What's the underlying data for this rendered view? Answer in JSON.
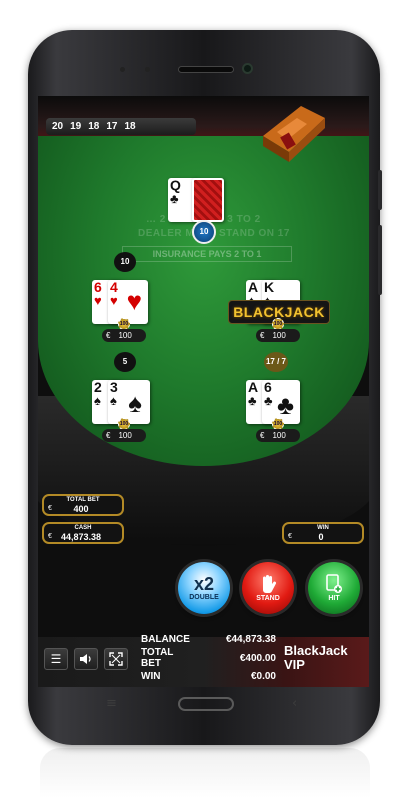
{
  "history": [
    "20",
    "19",
    "18",
    "17",
    "18"
  ],
  "dealer": {
    "cards": [
      {
        "rank": "Q",
        "suit": "♣",
        "color": "blk"
      },
      {
        "rank": "",
        "suit": "",
        "color": "back"
      }
    ],
    "score": "10"
  },
  "felt_text": {
    "line1": "…  2 TO 1 PAYS 3 TO 2",
    "line2": "DEALER MUST STAND ON 17",
    "insurance": "INSURANCE PAYS 2 TO 1"
  },
  "hands": [
    {
      "score": "10",
      "cards": [
        {
          "rank": "6",
          "suit": "♥",
          "color": "red"
        },
        {
          "rank": "4",
          "suit": "♥",
          "color": "red"
        }
      ],
      "bet": "100",
      "currency": "€"
    },
    {
      "score": "",
      "cards": [
        {
          "rank": "A",
          "suit": "♠",
          "color": "blk"
        },
        {
          "rank": "K",
          "suit": "♠",
          "color": "blk"
        }
      ],
      "bet": "100",
      "currency": "€",
      "badge": "BLACKJACK"
    },
    {
      "score": "5",
      "cards": [
        {
          "rank": "2",
          "suit": "♠",
          "color": "blk"
        },
        {
          "rank": "3",
          "suit": "♠",
          "color": "blk"
        }
      ],
      "bet": "100",
      "currency": "€"
    },
    {
      "score": "17 / 7",
      "cards": [
        {
          "rank": "A",
          "suit": "♣",
          "color": "blk"
        },
        {
          "rank": "6",
          "suit": "♣",
          "color": "blk"
        }
      ],
      "bet": "100",
      "currency": "€"
    }
  ],
  "chip_label": "100",
  "info": {
    "total_bet_label": "TOTAL BET",
    "total_bet": "400",
    "cash_label": "CASH",
    "cash": "44,873.38",
    "win_label": "WIN",
    "win": "0",
    "currency": "€"
  },
  "actions": {
    "double_big": "x2",
    "double_label": "DOUBLE",
    "stand_label": "STAND",
    "hit_label": "HIT"
  },
  "summary": {
    "balance_label": "BALANCE",
    "balance": "€44,873.38",
    "total_bet_label_1": "TOTAL",
    "total_bet_label_2": "BET",
    "total_bet": "€400.00",
    "win_label": "WIN",
    "win": "€0.00"
  },
  "game_name": "BlackJack VIP",
  "colors": {
    "felt": "#1f7a2c",
    "gold": "#f2c230",
    "double": "#159be8",
    "stand": "#e11a12",
    "hit": "#1faa36"
  }
}
